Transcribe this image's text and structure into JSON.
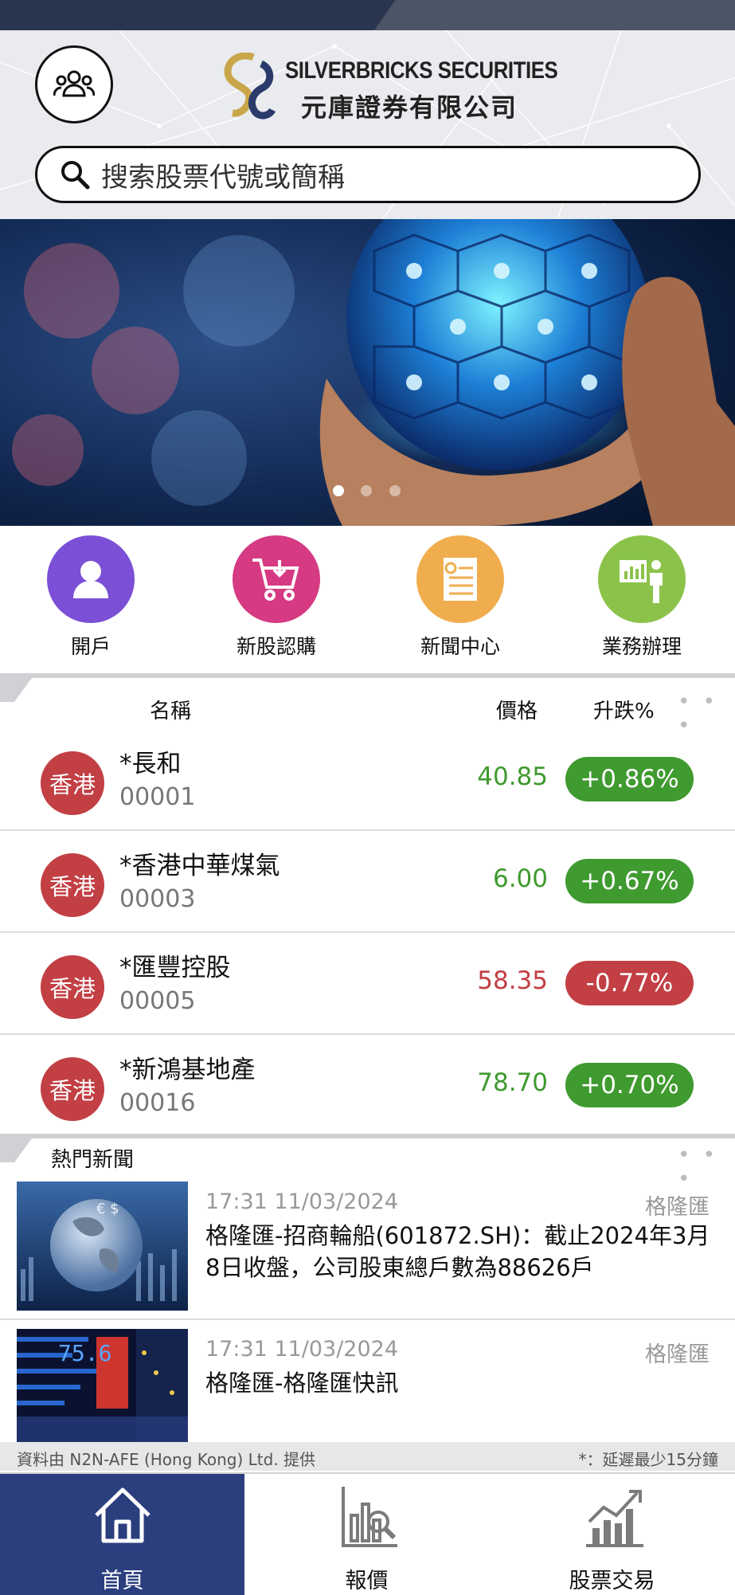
{
  "header": {
    "logo_en": "SILVERBRICKS SECURITIES",
    "logo_zh": "元庫證券有限公司",
    "account_icon": "group-users-icon"
  },
  "search": {
    "placeholder": "搜索股票代號或簡稱"
  },
  "banner": {
    "slide_count": 3,
    "active_slide": 1
  },
  "quick_actions": [
    {
      "label": "開戶",
      "color": "#7b4fd6",
      "icon": "person-icon"
    },
    {
      "label": "新股認購",
      "color": "#d63a83",
      "icon": "cart-download-icon"
    },
    {
      "label": "新聞中心",
      "color": "#f0ad4e",
      "icon": "news-document-icon"
    },
    {
      "label": "業務辦理",
      "color": "#8bc34a",
      "icon": "presentation-icon"
    }
  ],
  "quotes": {
    "headers": {
      "name": "名稱",
      "price": "價格",
      "change": "升跌%"
    },
    "more": "• • •",
    "rows": [
      {
        "market": "香港",
        "name": "*長和",
        "code": "00001",
        "price": "40.85",
        "change": "+0.86%",
        "direction": "up"
      },
      {
        "market": "香港",
        "name": "*香港中華煤氣",
        "code": "00003",
        "price": "6.00",
        "change": "+0.67%",
        "direction": "up"
      },
      {
        "market": "香港",
        "name": "*匯豐控股",
        "code": "00005",
        "price": "58.35",
        "change": "-0.77%",
        "direction": "down"
      },
      {
        "market": "香港",
        "name": "*新鴻基地產",
        "code": "00016",
        "price": "78.70",
        "change": "+0.70%",
        "direction": "up"
      }
    ]
  },
  "news": {
    "title": "熱門新聞",
    "more": "• • •",
    "items": [
      {
        "time": "17:31   11/03/2024",
        "source": "格隆匯",
        "headline": "格隆匯-招商輪船(601872.SH)：截止2024年3月8日收盤，公司股東總戶數為88626戶"
      },
      {
        "time": "17:31   11/03/2024",
        "source": "格隆匯",
        "headline": "格隆匯-格隆匯快訊"
      }
    ]
  },
  "footer": {
    "provider": "資料由 N2N-AFE (Hong Kong) Ltd. 提供",
    "delay_note": "*：延遲最少15分鐘"
  },
  "nav": [
    {
      "label": "首頁",
      "icon": "home-icon",
      "active": true
    },
    {
      "label": "報價",
      "icon": "quote-chart-icon",
      "active": false
    },
    {
      "label": "股票交易",
      "icon": "trading-chart-icon",
      "active": false
    }
  ],
  "colors": {
    "up": "#3f9a2f",
    "down": "#c23f44",
    "nav_active": "#2b3e7e"
  }
}
